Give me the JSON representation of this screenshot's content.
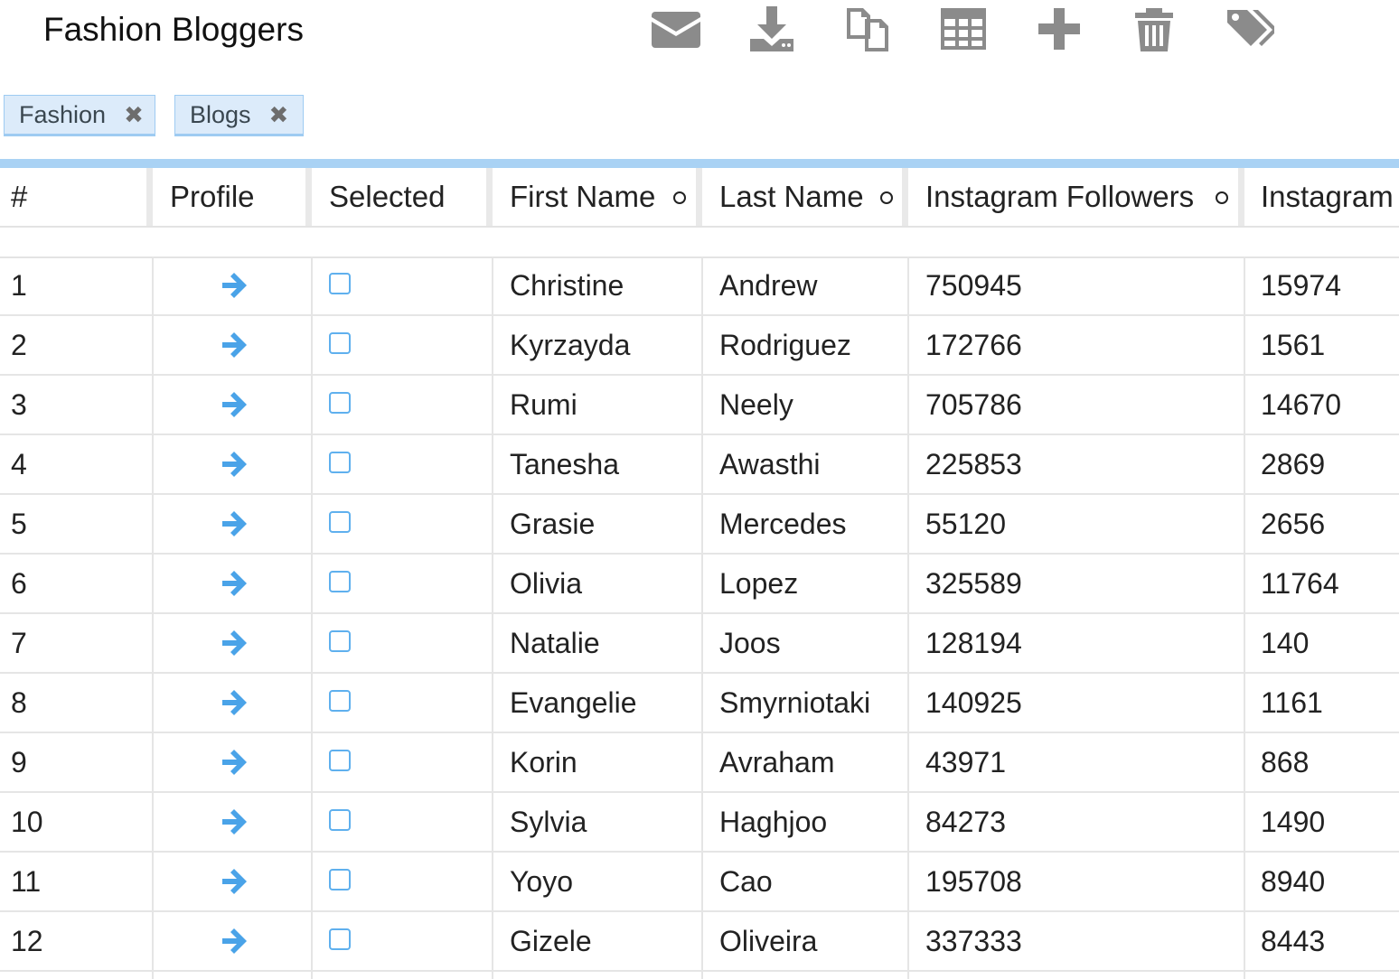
{
  "title": "Fashion Bloggers",
  "toolbar": {
    "icons": [
      "envelope-icon",
      "download-icon",
      "copy-icon",
      "table-icon",
      "plus-icon",
      "trash-icon",
      "tags-icon"
    ]
  },
  "filters": [
    {
      "label": "Fashion"
    },
    {
      "label": "Blogs"
    }
  ],
  "table": {
    "columns": {
      "num": "#",
      "profile": "Profile",
      "selected": "Selected",
      "first_name": "First Name",
      "last_name": "Last Name",
      "ig_followers": "Instagram Followers",
      "ig_next": "Instagram"
    },
    "rows": [
      {
        "num": "1",
        "first": "Christine",
        "last": "Andrew",
        "followers": "750945",
        "ig": "15974"
      },
      {
        "num": "2",
        "first": "Kyrzayda",
        "last": "Rodriguez",
        "followers": "172766",
        "ig": "1561"
      },
      {
        "num": "3",
        "first": "Rumi",
        "last": "Neely",
        "followers": "705786",
        "ig": "14670"
      },
      {
        "num": "4",
        "first": "Tanesha",
        "last": "Awasthi",
        "followers": "225853",
        "ig": "2869"
      },
      {
        "num": "5",
        "first": "Grasie",
        "last": "Mercedes",
        "followers": "55120",
        "ig": "2656"
      },
      {
        "num": "6",
        "first": "Olivia",
        "last": "Lopez",
        "followers": "325589",
        "ig": "11764"
      },
      {
        "num": "7",
        "first": "Natalie",
        "last": "Joos",
        "followers": "128194",
        "ig": "140"
      },
      {
        "num": "8",
        "first": "Evangelie",
        "last": "Smyrniotaki",
        "followers": "140925",
        "ig": "1161"
      },
      {
        "num": "9",
        "first": "Korin",
        "last": "Avraham",
        "followers": "43971",
        "ig": "868"
      },
      {
        "num": "10",
        "first": "Sylvia",
        "last": "Haghjoo",
        "followers": "84273",
        "ig": "1490"
      },
      {
        "num": "11",
        "first": "Yoyo",
        "last": "Cao",
        "followers": "195708",
        "ig": "8940"
      },
      {
        "num": "12",
        "first": "Gizele",
        "last": "Oliveira",
        "followers": "337333",
        "ig": "8443"
      }
    ]
  },
  "colors": {
    "accent": "#4aa3e8",
    "chip_bg": "#dcebfa",
    "rule": "#a9d2f4",
    "icon_gray": "#8b8b8b"
  }
}
